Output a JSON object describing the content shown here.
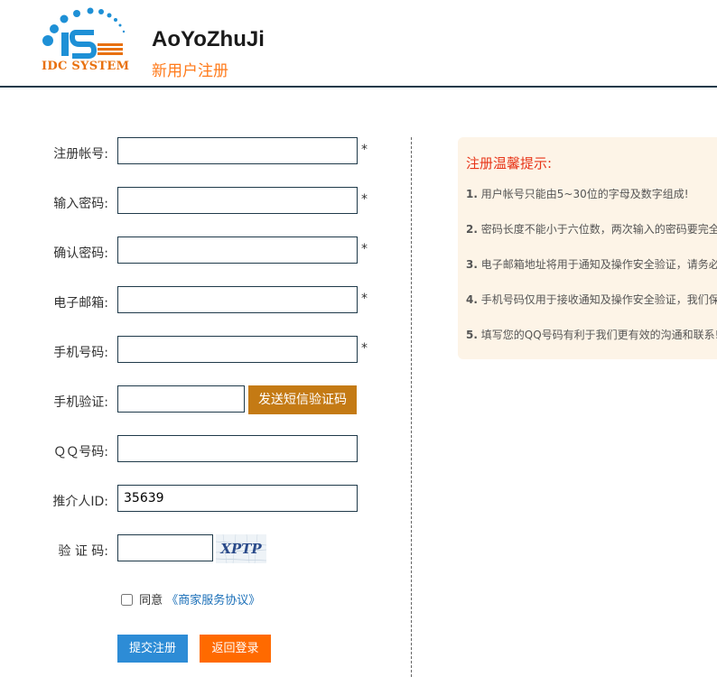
{
  "header": {
    "logo_text": "IDC SYSTEM",
    "site_title": "AoYoZhuJi",
    "subtitle": "新用户注册"
  },
  "form": {
    "fields": [
      {
        "label": "注册帐号:",
        "value": "",
        "required": "*"
      },
      {
        "label": "输入密码:",
        "value": "",
        "required": "*"
      },
      {
        "label": "确认密码:",
        "value": "",
        "required": "*"
      },
      {
        "label": "电子邮箱:",
        "value": "",
        "required": "*"
      },
      {
        "label": "手机号码:",
        "value": "",
        "required": "*"
      },
      {
        "label": "手机验证:",
        "value": ""
      },
      {
        "label": "ＱＱ号码:",
        "value": ""
      },
      {
        "label": "推介人ID:",
        "value": "35639"
      },
      {
        "label": "验 证 码:",
        "value": ""
      }
    ],
    "sms_button": "发送短信验证码",
    "captcha_text": "XPTP",
    "agree_text": "同意",
    "agreement_link": "《商家服务协议》",
    "submit_button": "提交注册",
    "back_button": "返回登录"
  },
  "tips": {
    "title": "注册温馨提示:",
    "items": [
      {
        "num": "1.",
        "text": "用户帐号只能由5~30位的字母及数字组成!"
      },
      {
        "num": "2.",
        "text": "密码长度不能小于六位数，两次输入的密码要完全一致!"
      },
      {
        "num": "3.",
        "text": "电子邮箱地址将用于通知及操作安全验证，请务必填写正确!"
      },
      {
        "num": "4.",
        "text": "手机号码仅用于接收通知及操作安全验证，我们保证不会泄露!"
      },
      {
        "num": "5.",
        "text": "填写您的QQ号码有利于我们更有效的沟通和联系!"
      }
    ]
  },
  "colors": {
    "brand_orange": "#ff7a1a",
    "logo_blue": "#1e90d6",
    "submit_blue": "#2d8cd6",
    "back_orange": "#ff6a00",
    "sms_brown": "#c47a14",
    "tips_bg": "#fdf4e7",
    "tips_title_red": "#e8361a"
  }
}
